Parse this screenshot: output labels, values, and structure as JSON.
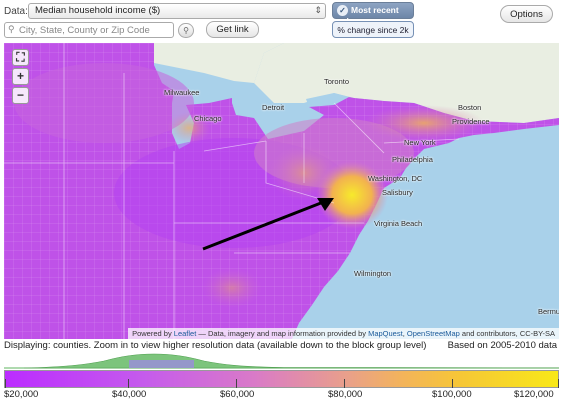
{
  "controls": {
    "data_label": "Data:",
    "data_select_value": "Median household income ($)",
    "most_recent_label": "Most recent value",
    "change_label": "% change since 2k",
    "options_label": "Options",
    "search_placeholder": "City, State, County or Zip Code",
    "get_link_label": "Get link"
  },
  "map": {
    "attribution_prefix": "Powered by",
    "attribution_leaflet": "Leaflet",
    "attribution_mid": " — Data, imagery and map information provided by ",
    "attribution_mapquest": "MapQuest",
    "attribution_sep": ", ",
    "attribution_osm": "OpenStreetMap",
    "attribution_end": " and contributors, CC-BY-SA",
    "city_labels": [
      "Milwaukee",
      "Chicago",
      "Detroit",
      "Toronto",
      "Boston",
      "Providence",
      "New York",
      "Philadelphia",
      "Washington, DC",
      "Salisbury",
      "Virginia Beach",
      "Wilmington",
      "Bermu"
    ],
    "colors": {
      "ocean": "#a9d1ea",
      "canada": "#e9eee2",
      "low": "#b43ef0",
      "mid": "#cf66d7",
      "high": "#f2b24f",
      "top": "#f5e52a"
    }
  },
  "status": {
    "left": "Displaying: counties. Zoom in to view higher resolution data (available down to the block group level)",
    "right": "Based on 2005-2010 data"
  },
  "legend": {
    "labels": [
      "$20,000",
      "$40,000",
      "$60,000",
      "$80,000",
      "$100,000",
      "$120,000"
    ],
    "min": 20000,
    "max": 120000
  }
}
